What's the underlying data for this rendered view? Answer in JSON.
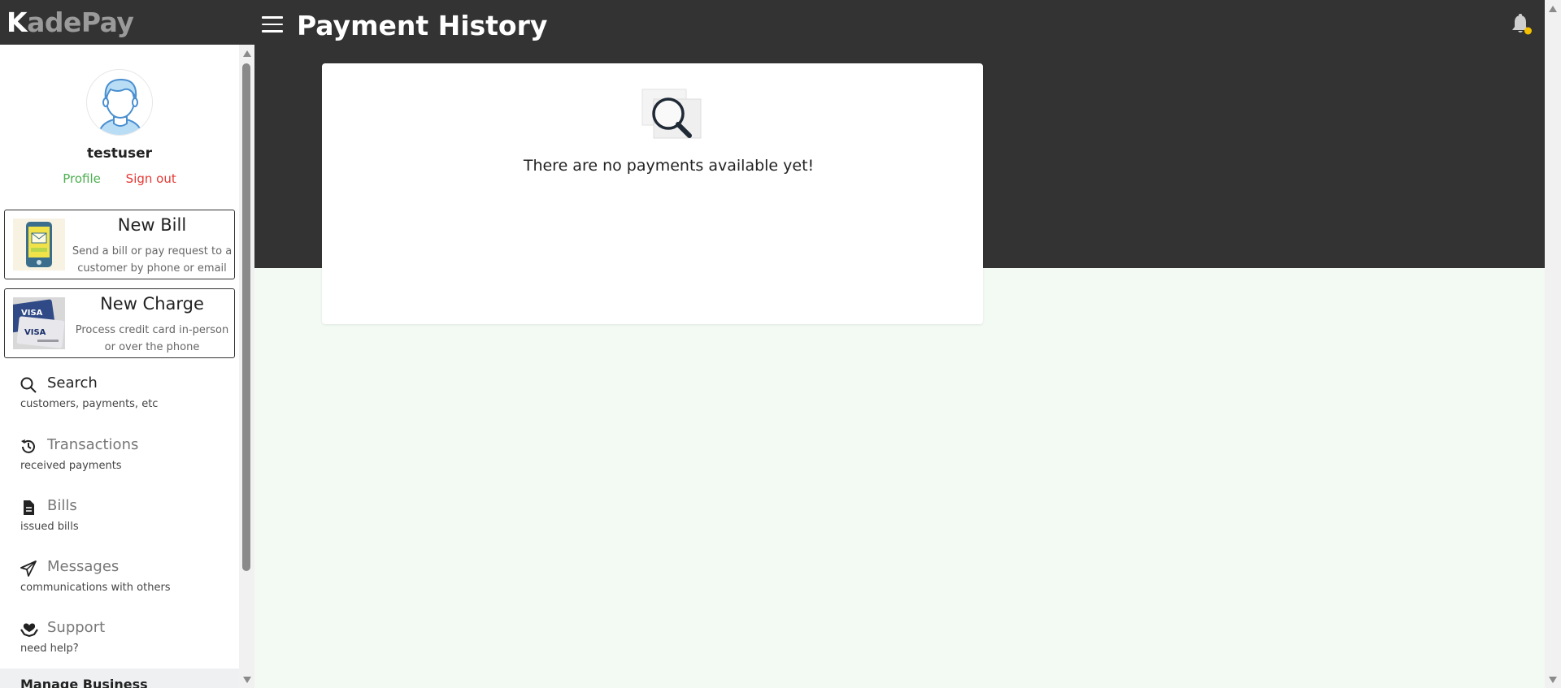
{
  "app": {
    "logo_first": "K",
    "logo_rest": "adePay"
  },
  "header": {
    "title": "Payment History"
  },
  "sidebar": {
    "username": "testuser",
    "profile_link": "Profile",
    "signout_link": "Sign out",
    "cards": [
      {
        "title": "New Bill",
        "description": "Send a bill or pay request to a customer by phone or email"
      },
      {
        "title": "New Charge",
        "description": "Process credit card in-person or over the phone"
      }
    ],
    "items": [
      {
        "label": "Search",
        "sub": "customers, payments, etc"
      },
      {
        "label": "Transactions",
        "sub": "received payments"
      },
      {
        "label": "Bills",
        "sub": "issued bills"
      },
      {
        "label": "Messages",
        "sub": "communications with others"
      },
      {
        "label": "Support",
        "sub": "need help?"
      }
    ],
    "manage_label": "Manage Business"
  },
  "main": {
    "empty_message": "There are no payments available yet!"
  },
  "colors": {
    "topbar": "#333333",
    "background": "#f3f9f3",
    "profile_link": "#4caf50",
    "signout_link": "#e53935",
    "notification_dot": "#f5c000"
  }
}
